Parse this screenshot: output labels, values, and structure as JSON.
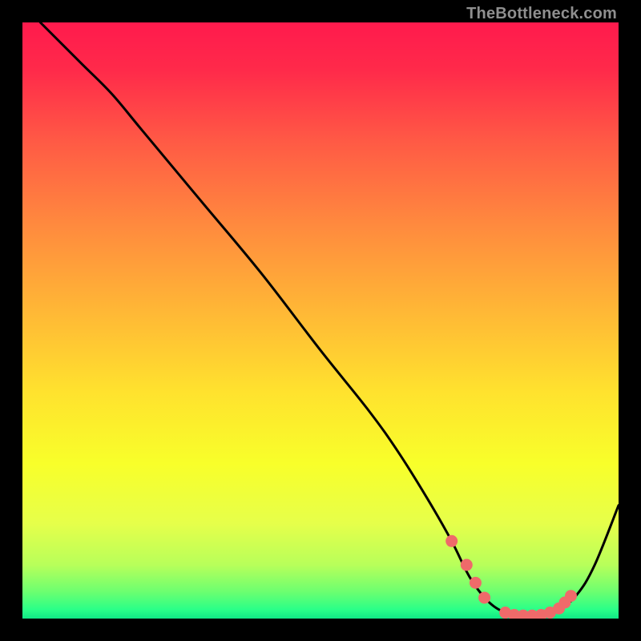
{
  "watermark": "TheBottleneck.com",
  "gradient": {
    "stops": [
      {
        "offset": 0.0,
        "color": "#ff1a4d"
      },
      {
        "offset": 0.08,
        "color": "#ff2a4a"
      },
      {
        "offset": 0.2,
        "color": "#ff5a45"
      },
      {
        "offset": 0.34,
        "color": "#ff8a3e"
      },
      {
        "offset": 0.48,
        "color": "#ffb636"
      },
      {
        "offset": 0.62,
        "color": "#ffe22e"
      },
      {
        "offset": 0.74,
        "color": "#f8ff2a"
      },
      {
        "offset": 0.84,
        "color": "#e6ff4a"
      },
      {
        "offset": 0.91,
        "color": "#b8ff5a"
      },
      {
        "offset": 0.955,
        "color": "#6cff70"
      },
      {
        "offset": 0.985,
        "color": "#2aff88"
      },
      {
        "offset": 1.0,
        "color": "#10e886"
      }
    ]
  },
  "chart_data": {
    "type": "line",
    "title": "",
    "xlabel": "",
    "ylabel": "",
    "xlim": [
      0,
      100
    ],
    "ylim": [
      0,
      100
    ],
    "series": [
      {
        "name": "bottleneck-curve",
        "x": [
          3,
          6,
          10,
          15,
          20,
          30,
          40,
          50,
          58,
          63,
          68,
          72,
          75,
          78,
          81,
          84,
          87,
          90,
          93,
          96,
          100
        ],
        "y": [
          100,
          97,
          93,
          88,
          82,
          70,
          58,
          45,
          35,
          28,
          20,
          13,
          7,
          3,
          1,
          0.5,
          0.5,
          1.5,
          4,
          9,
          19
        ]
      }
    ],
    "markers": {
      "name": "optimal-range-dots",
      "x": [
        72,
        74.5,
        76,
        77.5,
        81,
        82.5,
        84,
        85.5,
        87,
        88.5,
        90,
        91,
        92
      ],
      "y": [
        13,
        9,
        6,
        3.5,
        1,
        0.6,
        0.5,
        0.5,
        0.6,
        1,
        1.7,
        2.7,
        3.8
      ]
    }
  }
}
